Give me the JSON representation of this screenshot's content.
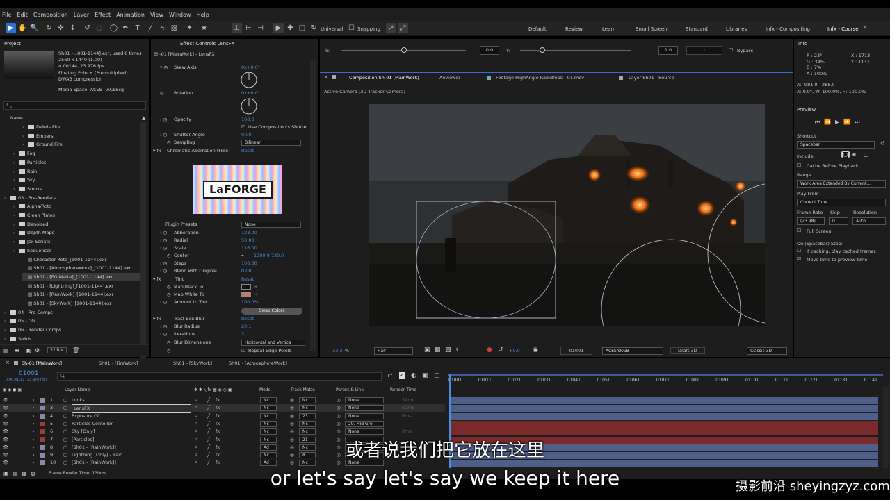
{
  "menu": [
    "File",
    "Edit",
    "Composition",
    "Layer",
    "Effect",
    "Animation",
    "View",
    "Window",
    "Help"
  ],
  "toolbar": {
    "universal": "Universal",
    "snapping": "Snapping"
  },
  "workspaces": [
    "Default",
    "Review",
    "Learn",
    "Small Screen",
    "Standard",
    "Libraries",
    "Infx - Compositing",
    "Infx - Course"
  ],
  "project": {
    "title": "Project",
    "asset_name": "Sh01 - ..001-1144].exr",
    "asset_used": ", used 6 times",
    "asset_dims": "2560 x 1440 (1.00)",
    "asset_dur": "Δ 00144, 23.976 fps",
    "asset_depth": "Floating Point+ (Premultiplied)",
    "asset_comp": "DWAB compression",
    "media_space": "Media Space: ACES - ACEScg",
    "col_name": "Name",
    "bpc": "32 bpc",
    "items": [
      {
        "label": "Debris Fire",
        "type": "folder",
        "indent": 2
      },
      {
        "label": "Embers",
        "type": "folder",
        "indent": 2
      },
      {
        "label": "Ground Fire",
        "type": "folder",
        "indent": 2
      },
      {
        "label": "Fog",
        "type": "folder",
        "indent": 1
      },
      {
        "label": "Particles",
        "type": "folder",
        "indent": 1
      },
      {
        "label": "Rain",
        "type": "folder",
        "indent": 1
      },
      {
        "label": "Sky",
        "type": "folder",
        "indent": 1
      },
      {
        "label": "Smoke",
        "type": "folder",
        "indent": 1
      },
      {
        "label": "03 - Pre-Renders",
        "type": "folder",
        "indent": 0
      },
      {
        "label": "Alpha/Roto",
        "type": "folder",
        "indent": 1
      },
      {
        "label": "Clean Plates",
        "type": "folder",
        "indent": 1
      },
      {
        "label": "Denoised",
        "type": "folder",
        "indent": 1
      },
      {
        "label": "Depth Maps",
        "type": "folder",
        "indent": 1
      },
      {
        "label": "Jsx Scripts",
        "type": "folder",
        "indent": 1
      },
      {
        "label": "Sequences",
        "type": "folder",
        "indent": 1
      },
      {
        "label": "Character Roto_[1001-1144].exr",
        "type": "file",
        "indent": 2
      },
      {
        "label": "Sh01 - [AtmosphereWork]_[1001-1144].exr",
        "type": "file",
        "indent": 2
      },
      {
        "label": "Sh01 - [FG Matte]_[1001-1144].exr",
        "type": "file",
        "indent": 2,
        "selected": true
      },
      {
        "label": "Sh01 - [Lightning]_[1001-1144].exr",
        "type": "file",
        "indent": 2
      },
      {
        "label": "Sh01 - [RainWork]_[1001-1144].exr",
        "type": "file",
        "indent": 2
      },
      {
        "label": "Sh01 - [SkyWork]_[1001-1144].exr",
        "type": "file",
        "indent": 2
      },
      {
        "label": "04 - Pre-Comps",
        "type": "folder",
        "indent": 0
      },
      {
        "label": "05 - CG",
        "type": "folder",
        "indent": 0
      },
      {
        "label": "06 - Render Comps",
        "type": "folder",
        "indent": 0
      },
      {
        "label": "Solids",
        "type": "folder",
        "indent": 0
      }
    ]
  },
  "effects": {
    "title": "Effect Controls LensFX",
    "subtitle": "Sh-01 [MainWork] - LensFX",
    "skew_axis_label": "Skew Axis",
    "skew_axis_val": "0x+0.0°",
    "rotation_label": "Rotation",
    "rotation_val": "0x+0.0°",
    "opacity_label": "Opacity",
    "opacity_val": "100.0",
    "use_comp": "Use Composition's Shutte",
    "shutter_label": "Shutter Angle",
    "shutter_val": "0.00",
    "sampling_label": "Sampling",
    "sampling_val": "Bilinear",
    "chroma_label": "Chromatic Aberration (Free)",
    "reset": "Reset",
    "logo_a": "La",
    "logo_b": "FORGE",
    "plugin_presets_label": "Plugin Presets",
    "plugin_presets_val": "None",
    "abberation_label": "Abberation",
    "abberation_val": "123.00",
    "radial_label": "Radial",
    "radial_val": "50.00",
    "scale_label": "Scale",
    "scale_val": "116.00",
    "center_label": "Center",
    "center_val": "1280.0,720.0",
    "steps_label": "Steps",
    "steps_val": "100.00",
    "blend_label": "Blend with Original",
    "blend_val": "0.00",
    "tint_label": "Tint",
    "tint_reset": "Reset",
    "map_black": "Map Black To",
    "map_white": "Map White To",
    "amount_label": "Amount to Tint",
    "amount_val": "100.0%",
    "swap": "Swap Colors",
    "fbb_label": "Fast Box Blur",
    "fbb_reset": "Reset",
    "blur_radius_label": "Blur Radius",
    "blur_radius_val": "20.1",
    "iter_label": "Iterations",
    "iter_val": "3",
    "blur_dim_label": "Blur Dimensions",
    "blur_dim_val": "Horizontal and Vertica",
    "repeat_edge": "Repeat Edge Pixels"
  },
  "comp": {
    "g_label": "G:",
    "g_val": "0.0",
    "y_label": "Y:",
    "y_val": "1.0",
    "bypass": "Bypass",
    "tabs": [
      "Composition Sh-01 [MainWork]",
      "Aeviewer",
      "Footage HighAngle Raindrops - 01.mov",
      "Layer Sh01 - Source"
    ],
    "camera": "Active Camera (3D Tracker Camera)",
    "zoom": "33.3",
    "zoom_unit": "%",
    "res": "Half",
    "exposure": "+0.0",
    "frame": "01001",
    "color": "ACES/sRGB",
    "draft": "Draft 3D",
    "renderer": "Classic 3D"
  },
  "info": {
    "title": "Info",
    "r": "R : 23°",
    "g": "G : 34%",
    "b": "B : 7%",
    "a": "A : 100%",
    "x": "X : 1713",
    "y": "Y : 1131",
    "a_line": "A: -981.0, -288.0",
    "trans": "A: 0.0°, W: 100.0%, H: 100.0%"
  },
  "preview": {
    "title": "Preview",
    "shortcut_label": "Shortcut",
    "shortcut_val": "Spacebar",
    "include": "Include:",
    "cache": "Cache Before Playback",
    "range_label": "Range",
    "range_val": "Work Area Extended By Current...",
    "playfrom_label": "Play From",
    "playfrom_val": "Current Time",
    "fr_label": "Frame Rate",
    "skip_label": "Skip",
    "res_label": "Resolution",
    "fr_val": "(23.98)",
    "skip_val": "0",
    "res_val": "Auto",
    "fullscreen": "Full Screen",
    "stop_label": "On (Spacebar) Stop:",
    "if_caching": "If caching, play cached frames",
    "move_time": "Move time to preview time"
  },
  "timeline": {
    "tabs": [
      "Sh-01 [MainWork]",
      "Sh01 - [FireWork]",
      "Sh01 - [SkyWork]",
      "Sh01 - [AtmosphereWork]"
    ],
    "timecode": "01001",
    "timecode_sub": "0:00:41:17 (23.976 fps)",
    "col_layer": "Layer Name",
    "col_mode": "Mode",
    "col_trackmatte": "Track Matte",
    "col_parent": "Parent & Link",
    "col_render": "Render Time",
    "ruler": [
      "01001",
      "01011",
      "01021",
      "01031",
      "01041",
      "01051",
      "01061",
      "01071",
      "01081",
      "01091",
      "01101",
      "01111",
      "01121",
      "01131",
      "01141"
    ],
    "layers": [
      {
        "num": "1",
        "name": "Looks",
        "color": "#8a8aa8",
        "mode": "Nc",
        "tm": "Nc",
        "parent": "None",
        "render": "32ms",
        "track": "#4e5f8a"
      },
      {
        "num": "3",
        "name": "LensFX",
        "color": "#8a8aa8",
        "mode": "Nc",
        "tm": "Nc",
        "parent": "None",
        "render": "50ms",
        "track": "#4e5f8a",
        "selected": true
      },
      {
        "num": "4",
        "name": "Exposure CC",
        "color": "#8a8aa8",
        "mode": "Nc",
        "tm": "23",
        "parent": "None",
        "render": "6ms",
        "track": "#4e5f8a"
      },
      {
        "num": "5",
        "name": "Particles Contoller",
        "color": "#a03a3a",
        "mode": "Nc",
        "tm": "Nc",
        "parent": "29. Mid Gro",
        "render": "",
        "track": "#7a2a2a"
      },
      {
        "num": "6",
        "name": "Sky [Only]",
        "color": "#a03a3a",
        "mode": "Nc",
        "tm": "Nc",
        "parent": "None",
        "render": "0ms",
        "track": "#7a2a2a"
      },
      {
        "num": "7",
        "name": "[Particles]",
        "color": "#a03a3a",
        "mode": "Nc",
        "tm": "21",
        "parent": "",
        "render": "",
        "track": "#7a2a2a"
      },
      {
        "num": "8",
        "name": "[Sh01 - [RainWork]]",
        "color": "#8a8aa8",
        "mode": "Ad",
        "tm": "Nc",
        "parent": "None",
        "render": "",
        "track": "#4e5f8a"
      },
      {
        "num": "9",
        "name": "Lightning [Only] - Rain",
        "color": "#8a8aa8",
        "mode": "Nc",
        "tm": "8",
        "parent": "",
        "render": "",
        "track": "#4e5f8a"
      },
      {
        "num": "10",
        "name": "[Sh01 - [RainWork]]",
        "color": "#8a8aa8",
        "mode": "Ad",
        "tm": "Nc",
        "parent": "None",
        "render": "",
        "track": "#4e5f8a"
      }
    ],
    "frame_render": "Frame Render Time: 130ms"
  },
  "subtitles": {
    "cn": "或者说我们把它放在这里",
    "en": "or let's say let's say we keep it here"
  },
  "watermark": "摄影前沿 sheyingzyz.com",
  "colors": {
    "accent": "#2d6fd6",
    "link": "#4a8fe0"
  }
}
